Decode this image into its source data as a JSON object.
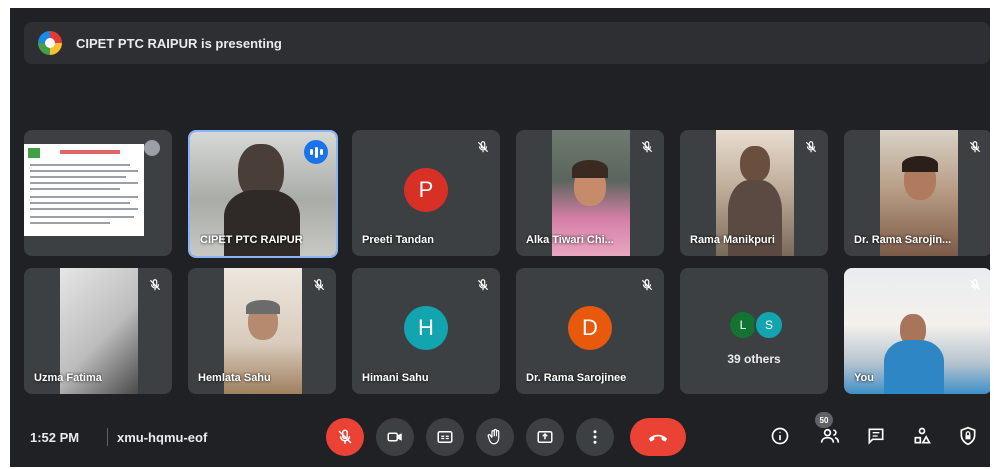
{
  "banner": {
    "text": "CIPET PTC RAIPUR is presenting"
  },
  "tiles": [
    {
      "name": "CIPET PTC RAIPUR",
      "status": "speaking"
    },
    {
      "name": "Preeti Tandan",
      "initial": "P",
      "avatar_color": "#d93025",
      "mic": "muted"
    },
    {
      "name": "Alka Tiwari Chi...",
      "mic": "muted"
    },
    {
      "name": "Rama Manikpuri",
      "mic": "muted"
    },
    {
      "name": "Dr. Rama Sarojin...",
      "mic": "muted"
    },
    {
      "name": "Uzma Fatima",
      "mic": "muted"
    },
    {
      "name": "Hemlata Sahu",
      "mic": "muted"
    },
    {
      "name": "Himani Sahu",
      "initial": "H",
      "avatar_color": "#12a4af",
      "mic": "muted"
    },
    {
      "name": "Dr. Rama Sarojinee",
      "initial": "D",
      "avatar_color": "#e8590c",
      "mic": "muted"
    },
    {
      "name": "You",
      "mic": "muted"
    }
  ],
  "others": {
    "label": "39 others",
    "avatars": [
      {
        "initial": "L",
        "color": "#137333"
      },
      {
        "initial": "S",
        "color": "#12a4af"
      }
    ]
  },
  "bottom_bar": {
    "time": "1:52 PM",
    "meeting_code": "xmu-hqmu-eof",
    "participant_count": "50",
    "icons": [
      "mic-off-icon",
      "camera-icon",
      "captions-icon",
      "raise-hand-icon",
      "present-icon",
      "more-icon",
      "end-call-icon",
      "info-icon",
      "people-icon",
      "chat-icon",
      "activities-icon",
      "host-controls-icon"
    ]
  },
  "colors": {
    "background": "#202124",
    "tile": "#3c4043",
    "accent": "#8ab4f8",
    "danger": "#ea4335"
  }
}
